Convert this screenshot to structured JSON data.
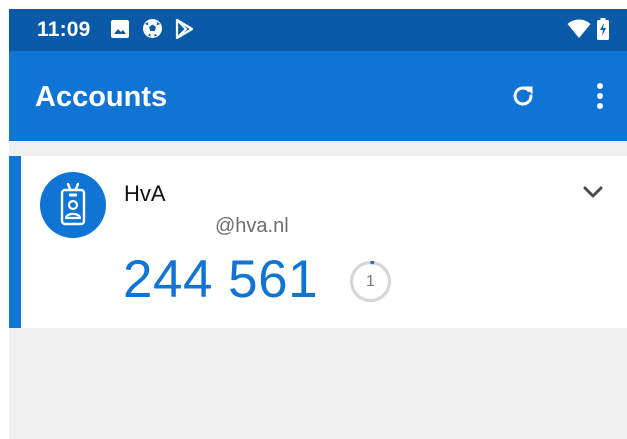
{
  "status_bar": {
    "time": "11:09",
    "left_icons": [
      "image-icon",
      "soccer-ball-icon",
      "play-store-icon"
    ],
    "right_icons": [
      "wifi-icon",
      "battery-charging-icon"
    ]
  },
  "app_bar": {
    "title": "Accounts",
    "actions": [
      "refresh-icon",
      "more-vert-icon"
    ]
  },
  "accounts": [
    {
      "name": "HvA",
      "email": "@hva.nl",
      "code": "244 561",
      "countdown": "1",
      "countdown_fraction": 0.03,
      "icon": "id-badge-icon"
    }
  ],
  "colors": {
    "status_bar": "#0b5aa8",
    "app_bar": "#0f74d4",
    "accent": "#0f74d4",
    "background": "#efefef"
  }
}
